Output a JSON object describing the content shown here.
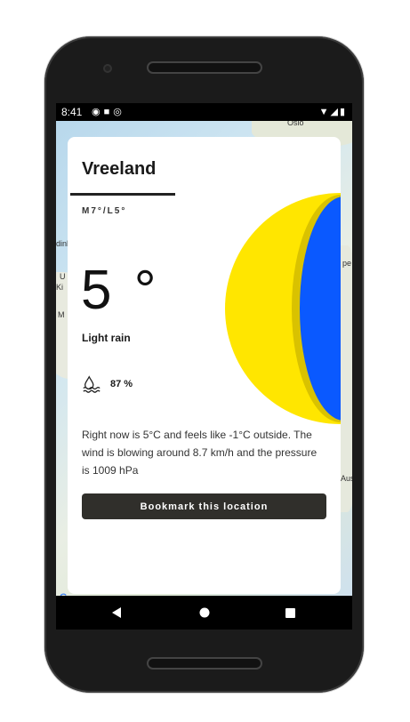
{
  "status_bar": {
    "time": "8:41",
    "left_icons": [
      "shield-icon",
      "sd-card-icon",
      "sync-icon"
    ],
    "right_icons": [
      "wifi-icon",
      "signal-icon",
      "battery-icon"
    ]
  },
  "map": {
    "labels": [
      "Oslo",
      "dinb",
      "U",
      "Ki",
      "M",
      "pe",
      "Aus"
    ],
    "attribution": "G"
  },
  "card": {
    "city": "Vreeland",
    "min_max": "M7°/L5°",
    "temperature": "5 °",
    "condition": "Light rain",
    "humidity_icon": "humidity-icon",
    "humidity": "87 %",
    "description": "Right now is 5°C and feels like -1°C outside. The wind is blowing around 8.7 km/h and the pressure is 1009 hPa",
    "bookmark_button": "Bookmark this location",
    "moon_colors": {
      "lit": "#ffe600",
      "shadow": "#0a59ff",
      "edge": "#d9c200"
    }
  },
  "nav_bar": {
    "back_icon": "back-triangle-icon",
    "home_icon": "home-circle-icon",
    "recents_icon": "recents-square-icon"
  }
}
